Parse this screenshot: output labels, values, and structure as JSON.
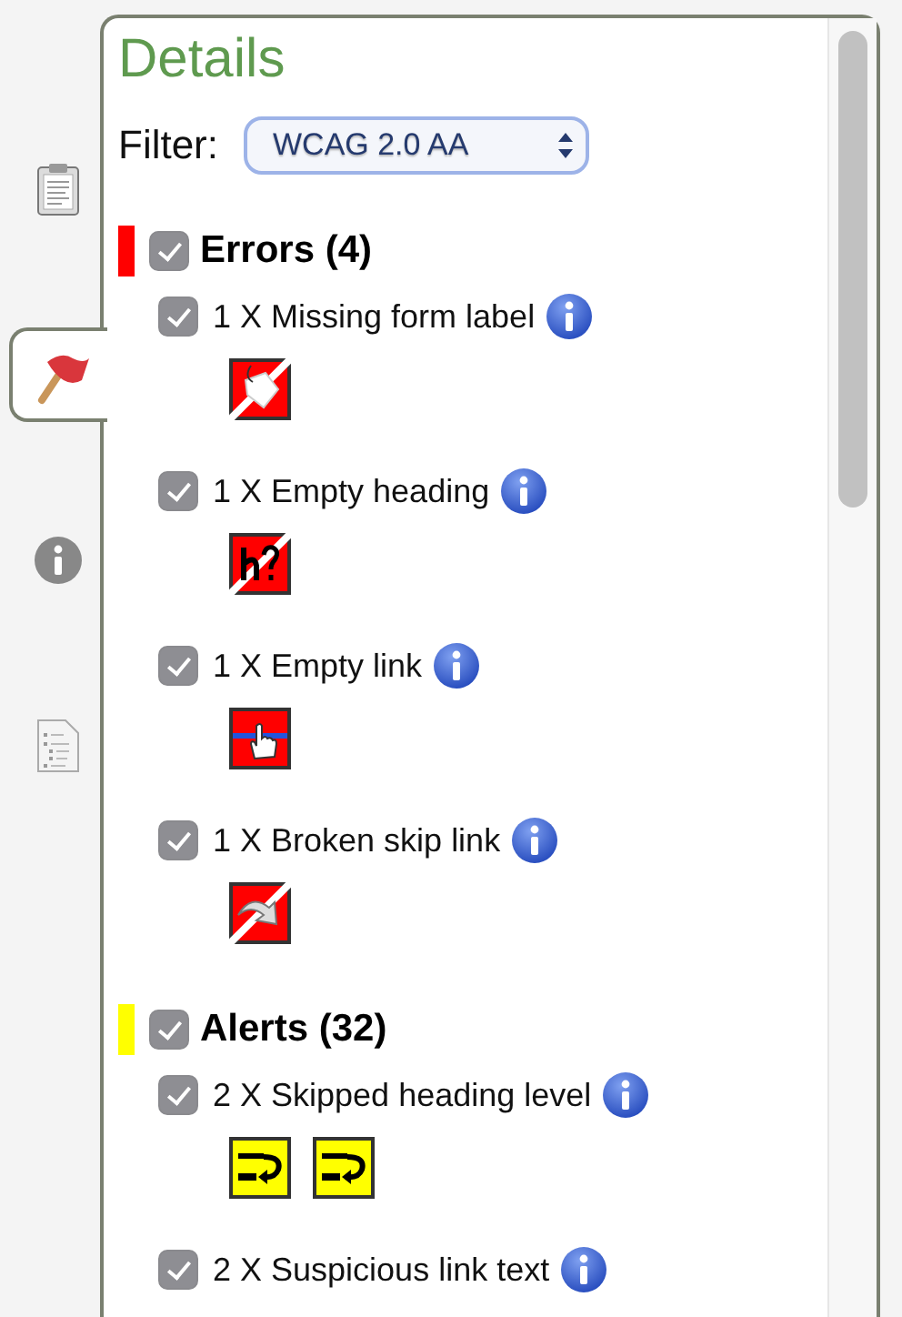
{
  "sidebar": {
    "tabs": [
      {
        "kind": "clipboard",
        "selected": false
      },
      {
        "kind": "flag",
        "selected": true
      },
      {
        "kind": "info",
        "selected": false
      },
      {
        "kind": "document",
        "selected": false
      }
    ]
  },
  "panel": {
    "title": "Details",
    "filter": {
      "label": "Filter:",
      "value": "WCAG 2.0 AA"
    },
    "categories": [
      {
        "title": "Errors (4)",
        "color": "#ff0000",
        "checked": true,
        "items": [
          {
            "label": "1 X Missing form label",
            "checked": true,
            "icons": [
              {
                "kind": "tag"
              }
            ]
          },
          {
            "label": "1 X Empty heading",
            "checked": true,
            "icons": [
              {
                "kind": "heading"
              }
            ]
          },
          {
            "label": "1 X Empty link",
            "checked": true,
            "icons": [
              {
                "kind": "link"
              }
            ]
          },
          {
            "label": "1 X Broken skip link",
            "checked": true,
            "icons": [
              {
                "kind": "skip"
              }
            ]
          }
        ]
      },
      {
        "title": "Alerts (32)",
        "color": "#ffff00",
        "checked": true,
        "items": [
          {
            "label": "2 X Skipped heading level",
            "checked": true,
            "icons": [
              {
                "kind": "level"
              },
              {
                "kind": "level"
              }
            ]
          },
          {
            "label": "2 X Suspicious link text",
            "checked": true
          }
        ]
      }
    ]
  }
}
